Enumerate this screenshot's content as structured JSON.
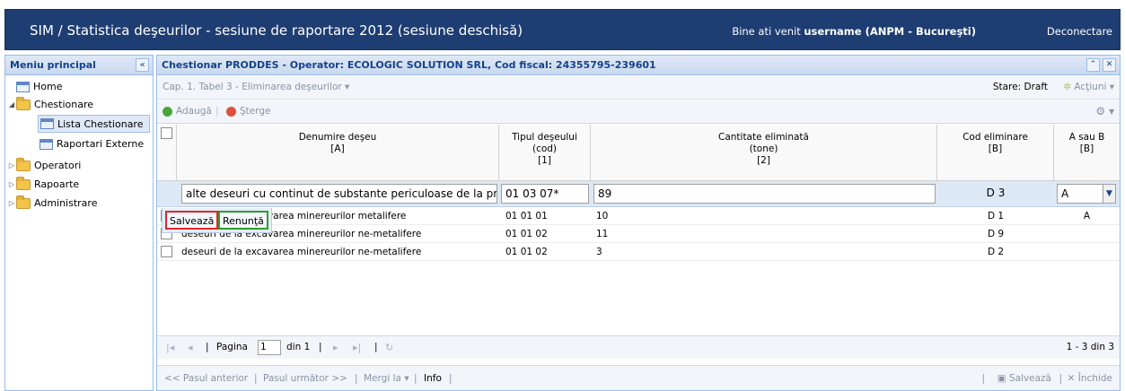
{
  "header": {
    "title": "SIM / Statistica deşeurilor  - sesiune de raportare 2012 (sesiune deschisă)",
    "welcome_prefix": "Bine ati venit ",
    "username": "username (ANPM - Bucureşti)",
    "logout": "Deconectare"
  },
  "menu": {
    "title": "Meniu principal",
    "collapse": "«",
    "items": [
      {
        "label": "Home"
      },
      {
        "label": "Chestionare"
      },
      {
        "label": "Lista Chestionare"
      },
      {
        "label": "Raportari Externe"
      },
      {
        "label": "Operatori"
      },
      {
        "label": "Rapoarte"
      },
      {
        "label": "Administrare"
      }
    ]
  },
  "panel": {
    "title": "Chestionar PRODDES - Operator: ECOLOGIC SOLUTION SRL, Cod fiscal: 24355795-239601",
    "chapter": "Cap. 1. Tabel 3 - Eliminarea deşeurilor ▾",
    "stare": "Stare: Draft",
    "actiuni": "Acţiuni ▾",
    "add": "Adaugă",
    "delete": "Şterge",
    "gear": "⚙ ▾"
  },
  "grid": {
    "columns": [
      {
        "l1": "Denumire deşeu",
        "l2": "",
        "l3": "[A]"
      },
      {
        "l1": "Tipul deşeului",
        "l2": "(cod)",
        "l3": "[1]"
      },
      {
        "l1": "Cantitate eliminată",
        "l2": "(tone)",
        "l3": "[2]"
      },
      {
        "l1": "Cod eliminare",
        "l2": "",
        "l3": "[B]"
      },
      {
        "l1": "A sau B",
        "l2": "",
        "l3": "[B]"
      }
    ],
    "editor": {
      "denumire": "alte deseuri cu continut de substante periculoase de la pro",
      "cod": "01 03 07*",
      "cantitate": "89",
      "cod_eliminare": "D 3",
      "a_sau_b": "A"
    },
    "rows": [
      {
        "denumire": "deseuri de la excavarea minereurilor metalifere",
        "cod": "01 01 01",
        "cantitate": "10",
        "cod_eliminare": "D 1",
        "a_sau_b": "A"
      },
      {
        "denumire": "deseuri de la excavarea minereurilor ne-metalifere",
        "cod": "01 01 02",
        "cantitate": "11",
        "cod_eliminare": "D 9",
        "a_sau_b": ""
      },
      {
        "denumire": "deseuri de la excavarea minereurilor ne-metalifere",
        "cod": "01 01 02",
        "cantitate": "3",
        "cod_eliminare": "D 2",
        "a_sau_b": ""
      }
    ],
    "save": "Salvează",
    "cancel": "Renunţă"
  },
  "pager": {
    "page_label": "Pagina",
    "page": "1",
    "of": "din 1",
    "summary": "1 - 3 din 3"
  },
  "footer": {
    "prev": "<< Pasul anterior",
    "next": "Pasul următor >>",
    "goto": "Mergi la ▾",
    "info": "Info",
    "save": "Salvează",
    "close": "Închide"
  },
  "colors": {
    "header_bg": "#1e3d73",
    "panel_header": "#dfe8f6",
    "add_icon": "#4aa53b",
    "delete_icon": "#e0503c",
    "save_highlight": "#e0262d",
    "cancel_highlight": "#2c9e2c"
  }
}
